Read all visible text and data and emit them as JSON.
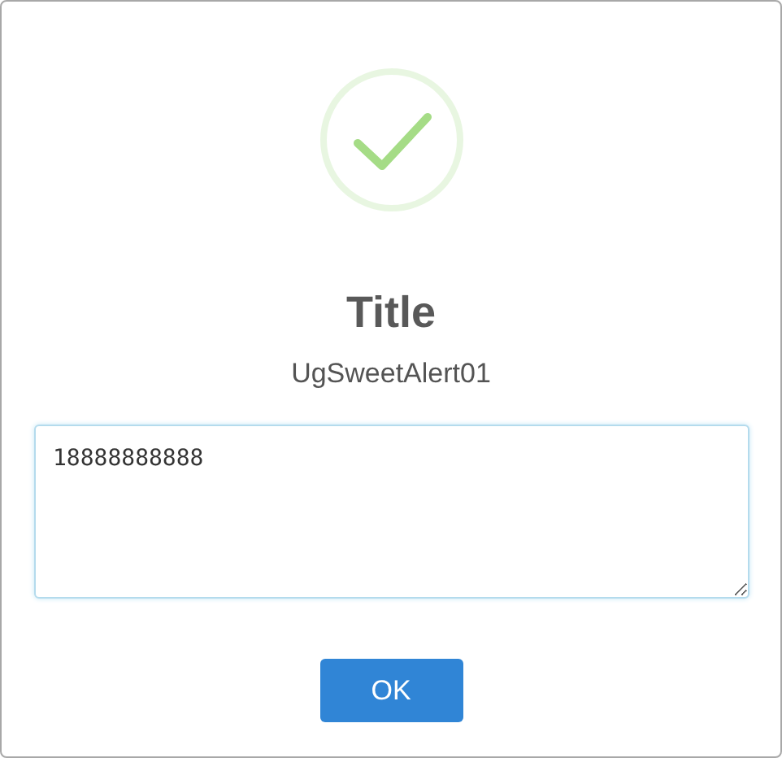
{
  "dialog": {
    "icon": {
      "kind": "success"
    },
    "title": "Title",
    "text": "UgSweetAlert01",
    "input": {
      "value": "18888888888"
    },
    "buttons": [
      {
        "label": "OK"
      }
    ]
  }
}
